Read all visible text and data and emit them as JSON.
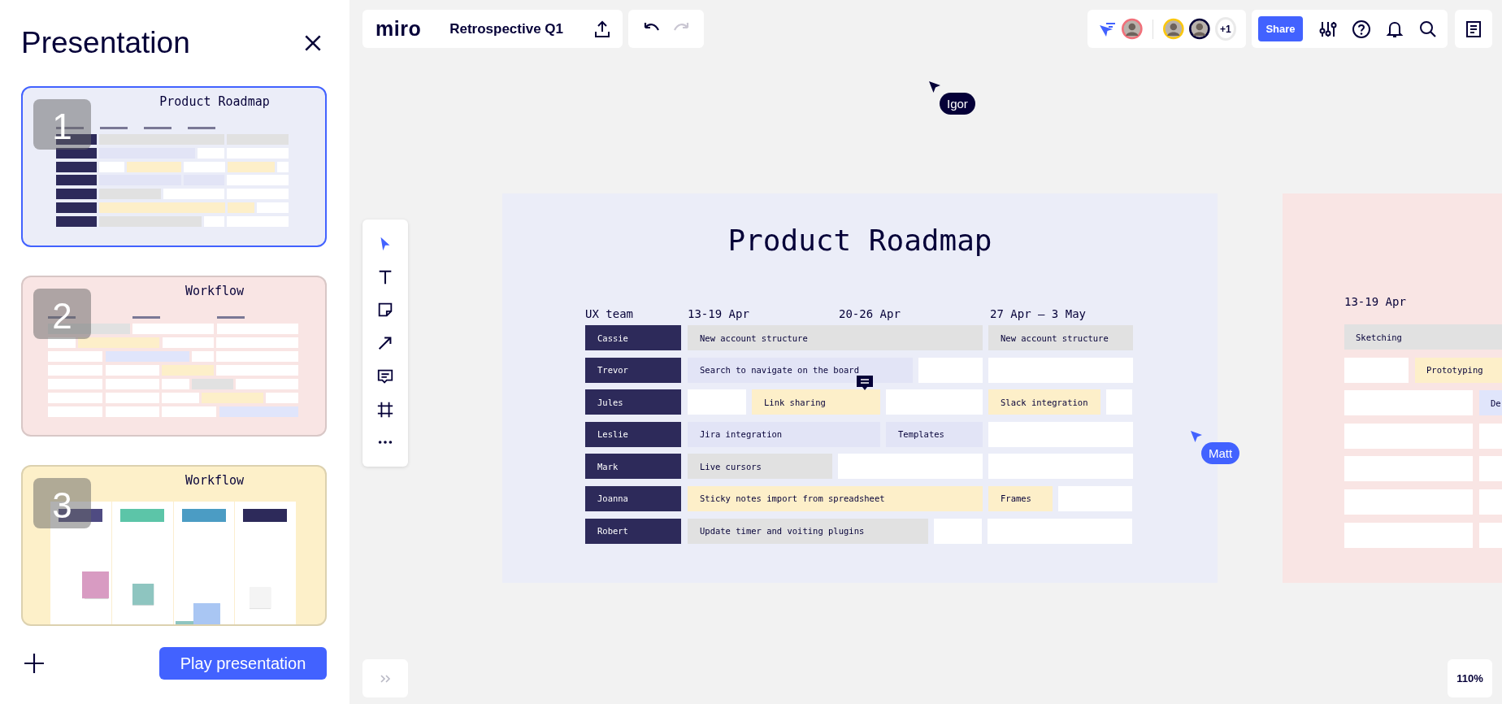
{
  "panel": {
    "title": "Presentation",
    "play_button": "Play presentation"
  },
  "slides": [
    {
      "number": "1",
      "selected": true,
      "kind": "roadmap",
      "title": "Product Roadmap"
    },
    {
      "number": "2",
      "selected": false,
      "kind": "timeline",
      "title": "Workflow"
    },
    {
      "number": "3",
      "selected": false,
      "kind": "kanban",
      "title": "Workflow"
    }
  ],
  "topbar": {
    "logo": "miro",
    "board_title": "Retrospective Q1",
    "undo": {
      "disabled": false
    },
    "redo": {
      "disabled": true
    },
    "collaborators": [
      {
        "color": "#f1707a"
      },
      {
        "color": "#fac710"
      },
      {
        "color": "#050038"
      }
    ],
    "more_count": "+1",
    "share_button": "Share"
  },
  "canvas": {
    "roadmap": {
      "title": "Product Roadmap",
      "team_label": "UX team",
      "weeks": [
        "13-19 Apr",
        "20-26 Apr",
        "27 Apr – 3 May"
      ],
      "rows": [
        {
          "name": "Cassie",
          "tasks": [
            {
              "text": "New account structure",
              "color": "#e1e1e1",
              "comment": false
            },
            {
              "text": "New account structure",
              "color": "#e1e1e1",
              "comment": false
            }
          ]
        },
        {
          "name": "Trevor",
          "tasks": [
            {
              "text": "Search to navigate on the board",
              "color": "#e2e4f6",
              "comment": false
            }
          ]
        },
        {
          "name": "Jules",
          "tasks": [
            {
              "text": "Link sharing",
              "color": "#fdefc9",
              "comment": true
            },
            {
              "text": "Slack integration",
              "color": "#fdefc9",
              "comment": false
            }
          ]
        },
        {
          "name": "Leslie",
          "tasks": [
            {
              "text": "Jira integration",
              "color": "#e2e4f6",
              "comment": false
            },
            {
              "text": "Templates",
              "color": "#e2e4f6",
              "comment": false
            }
          ]
        },
        {
          "name": "Mark",
          "tasks": [
            {
              "text": "Live cursors",
              "color": "#e1e1e1",
              "comment": false
            }
          ]
        },
        {
          "name": "Joanna",
          "tasks": [
            {
              "text": "Sticky notes import from spreadsheet",
              "color": "#fdefc9",
              "comment": false
            },
            {
              "text": "Frames",
              "color": "#fdefc9",
              "comment": false
            }
          ]
        },
        {
          "name": "Robert",
          "tasks": [
            {
              "text": "Update timer and voiting plugins",
              "color": "#e1e1e1",
              "comment": false
            }
          ]
        }
      ]
    },
    "workflow": {
      "weeks": [
        "13-19 Apr"
      ],
      "rows": [
        {
          "tasks": [
            {
              "text": "Sketching",
              "color": "#e1e1e1"
            }
          ]
        },
        {
          "tasks": [
            {
              "text": "Prototyping",
              "color": "#fdefc9"
            }
          ]
        },
        {
          "tasks": [
            {
              "text": "De",
              "color": "#e0e5fb"
            }
          ]
        }
      ]
    },
    "cursors": [
      {
        "name": "Igor",
        "color": "#050038"
      },
      {
        "name": "Matt",
        "color": "#4262ff"
      }
    ]
  },
  "zoom_level": "110%"
}
